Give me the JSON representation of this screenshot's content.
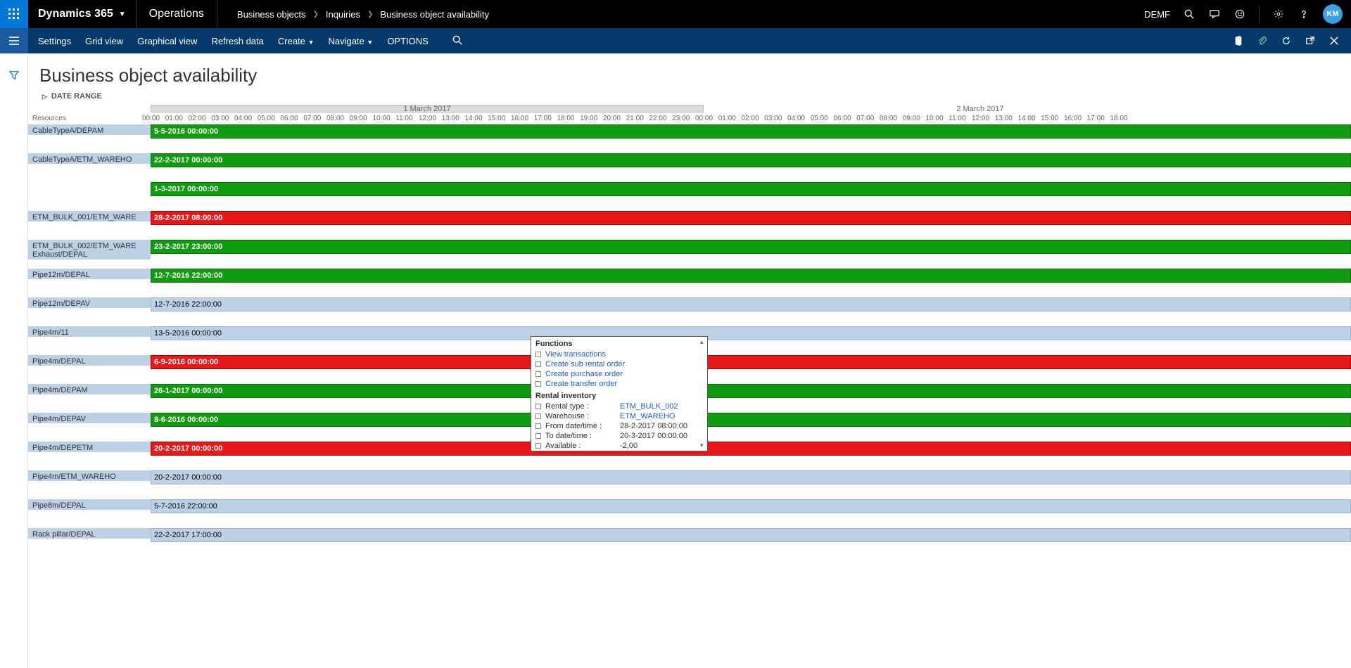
{
  "topbar": {
    "brand": "Dynamics 365",
    "module": "Operations",
    "crumbs": [
      "Business objects",
      "Inquiries",
      "Business object availability"
    ],
    "company": "DEMF",
    "avatar": "KM"
  },
  "actionbar": {
    "items": [
      "Settings",
      "Grid view",
      "Graphical view",
      "Refresh data",
      "Create",
      "Navigate",
      "OPTIONS"
    ]
  },
  "page": {
    "title": "Business object availability",
    "collapse": "DATE RANGE",
    "days": [
      "1 March 2017",
      "2 March 2017"
    ],
    "resources_label": "Resources"
  },
  "hours": [
    "00:00",
    "01:00",
    "02:00",
    "03:00",
    "04:00",
    "05:00",
    "06:00",
    "07:00",
    "08:00",
    "09:00",
    "10:00",
    "11:00",
    "12:00",
    "13:00",
    "14:00",
    "15:00",
    "16:00",
    "17:00",
    "18:00",
    "19:00",
    "20:00",
    "21:00",
    "22:00",
    "23:00",
    "00:00",
    "01:00",
    "02:00",
    "03:00",
    "04:00",
    "05:00",
    "06:00",
    "07:00",
    "08:00",
    "09:00",
    "10:00",
    "11:00",
    "12:00",
    "13:00",
    "14:00",
    "15:00",
    "16:00",
    "17:00",
    "18:00"
  ],
  "rows": [
    {
      "res": "CableTypeA/DEPAM",
      "label": "5-5-2016 00:00:00",
      "color": "green"
    },
    {
      "res": "CableTypeA/ETM_WAREHO",
      "label": "22-2-2017 00:00:00",
      "color": "green"
    },
    {
      "res": "",
      "label": "1-3-2017 00:00:00",
      "color": "green"
    },
    {
      "res": "ETM_BULK_001/ETM_WARE",
      "label": "28-2-2017 08:00:00",
      "color": "red"
    },
    {
      "res": "ETM_BULK_002/ETM_WARE\nExhaust/DEPAL",
      "label": "23-2-2017 23:00:00",
      "color": "green"
    },
    {
      "res": "Pipe12m/DEPAL",
      "label": "12-7-2016 22:00:00",
      "color": "green"
    },
    {
      "res": "Pipe12m/DEPAV",
      "label": "12-7-2016 22:00:00",
      "color": "grey"
    },
    {
      "res": "Pipe4m/11",
      "label": "13-5-2016 00:00:00",
      "color": "grey"
    },
    {
      "res": "Pipe4m/DEPAL",
      "label": "6-9-2016 00:00:00",
      "color": "red"
    },
    {
      "res": "Pipe4m/DEPAM",
      "label": "26-1-2017 00:00:00",
      "color": "green"
    },
    {
      "res": "Pipe4m/DEPAV",
      "label": "8-6-2016 00:00:00",
      "color": "green"
    },
    {
      "res": "Pipe4m/DEPETM",
      "label": "20-2-2017 00:00:00",
      "color": "red"
    },
    {
      "res": "Pipe4m/ETM_WAREHO",
      "label": "20-2-2017 00:00:00",
      "color": "grey"
    },
    {
      "res": "Pipe8m/DEPAL",
      "label": "5-7-2016 22:00:00",
      "color": "grey"
    },
    {
      "res": "Rack pillar/DEPAL",
      "label": "22-2-2017 17:00:00",
      "color": "grey"
    }
  ],
  "tooltip": {
    "h1": "Functions",
    "links": [
      "View transactions",
      "Create sub rental order",
      "Create purchase order",
      "Create transfer order"
    ],
    "h2": "Rental inventory",
    "kv": [
      {
        "k": "Rental type :",
        "v": "ETM_BULK_002",
        "link": true
      },
      {
        "k": "Warehouse :",
        "v": "ETM_WAREHO",
        "link": true
      },
      {
        "k": "From date/time :",
        "v": "28-2-2017 08:00:00",
        "link": false
      },
      {
        "k": "To date/time :",
        "v": "20-3-2017 00:00:00",
        "link": false
      },
      {
        "k": "Available :",
        "v": "-2,00",
        "link": false
      }
    ]
  }
}
